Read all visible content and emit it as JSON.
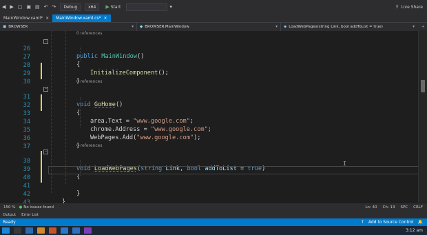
{
  "toolbar": {
    "config": "Debug",
    "platform": "x64",
    "start_label": "Start",
    "live_share": "Live Share"
  },
  "tabs": [
    {
      "label": "MainWindow.xaml*",
      "active": false
    },
    {
      "label": "MainWindow.xaml.cs*",
      "active": true
    }
  ],
  "navbar": {
    "project": "BROWSER",
    "class": "BROWSER.MainWindow",
    "member": "LoadWebPages(string Link, bool addToList = true)"
  },
  "code": {
    "ref_label": "0 references",
    "l26": {
      "num": "26",
      "kw": "public",
      "name": "MainWindow",
      "rest": "()"
    },
    "l27": {
      "num": "27",
      "text": "{"
    },
    "l28": {
      "num": "28",
      "fn": "InitializeComponent",
      "rest": "();"
    },
    "l29": {
      "num": "29",
      "text": "}"
    },
    "l30": {
      "num": "30"
    },
    "l31": {
      "num": "31",
      "kw": "void",
      "name": "GoHome",
      "rest": "()"
    },
    "l32": {
      "num": "32",
      "text": "{"
    },
    "l33": {
      "num": "33",
      "a": "area.Text = ",
      "s": "\"www.google.com\"",
      "e": ";"
    },
    "l34": {
      "num": "34",
      "a": "chrome.Address = ",
      "s": "\"www.google.com\"",
      "e": ";"
    },
    "l35": {
      "num": "35",
      "a": "WebPages.Add(",
      "s": "\"www.google.com\"",
      "e": ");"
    },
    "l36": {
      "num": "36",
      "text": "}"
    },
    "l37": {
      "num": "37"
    },
    "l38": {
      "num": "38",
      "kw": "void",
      "name": "LoadWebPages",
      "open": "(",
      "t1": "string",
      "p1": " Link, ",
      "t2": "bool",
      "p2": " addToList = ",
      "v": "true",
      "close": ")"
    },
    "l39": {
      "num": "39",
      "text": "{"
    },
    "l40": {
      "num": "40"
    },
    "l41": {
      "num": "41",
      "text": "}"
    },
    "l42": {
      "num": "42",
      "text": "}"
    },
    "l43": {
      "num": "43",
      "text": "}"
    },
    "l44": {
      "num": "44"
    }
  },
  "status": {
    "zoom": "150 %",
    "issues": "No issues found",
    "ln": "Ln: 40",
    "ch": "Ch: 13",
    "spc": "SPC",
    "crlf": "CRLF"
  },
  "panels": {
    "output": "Output",
    "errors": "Error List"
  },
  "statusbar": {
    "ready": "Ready",
    "source_control": "Add to Source Control"
  },
  "taskbar": {
    "time": "3:12 am"
  },
  "colors": {
    "accent": "#007acc",
    "keyword": "#569cd6",
    "string": "#d69d85",
    "linenum": "#2b91af",
    "change": "#e6d04a"
  }
}
